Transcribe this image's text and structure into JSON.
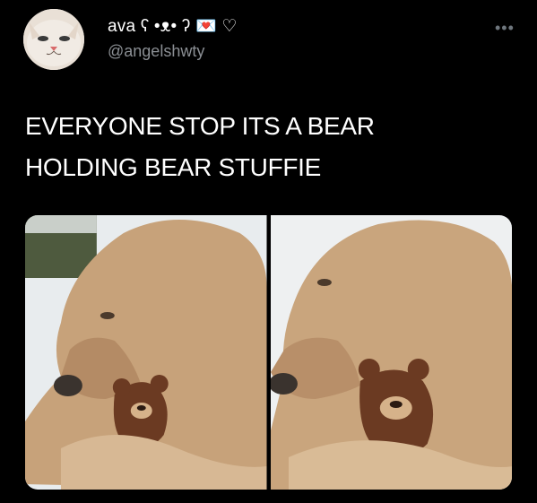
{
  "tweet": {
    "author": {
      "display_name": "ava ʕ •ᴥ• ʔ 💌 ♡",
      "handle": "@angelshwty",
      "avatar_icon": "cat-face-avatar"
    },
    "more_icon": "more-options-icon",
    "text_lines": [
      "EVERYONE STOP ITS A BEAR",
      "HOLDING BEAR STUFFIE"
    ],
    "media": [
      {
        "subject": "bear-with-teddy-photo"
      },
      {
        "subject": "bear-with-teddy-photo-closeup"
      }
    ]
  },
  "colors": {
    "background": "#000000",
    "text": "#ffffff",
    "muted": "#8b8f94"
  }
}
